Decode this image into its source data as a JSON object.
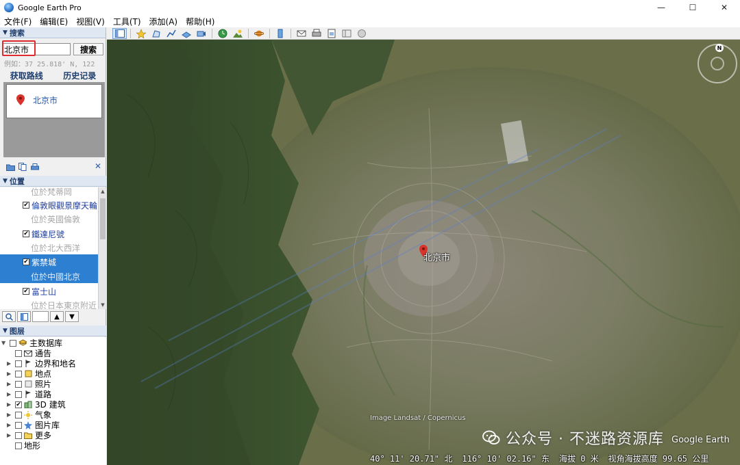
{
  "window": {
    "title": "Google Earth Pro",
    "minimize": "—",
    "maximize": "☐",
    "close": "✕"
  },
  "menu": [
    "文件(F)",
    "编辑(E)",
    "视图(V)",
    "工具(T)",
    "添加(A)",
    "帮助(H)"
  ],
  "search": {
    "section_title": "搜索",
    "value": "北京市",
    "button": "搜索",
    "example": "例如：37 25.818' N, 122",
    "link_route": "获取路线",
    "link_history": "历史记录",
    "result": "北京市"
  },
  "places": {
    "section_title": "位置",
    "rows": [
      {
        "sub": "位於梵蒂岡"
      },
      {
        "name": "倫敦眼觀景摩天輪",
        "checked": "✔"
      },
      {
        "sub": "位於英國倫敦"
      },
      {
        "name": "鐵達尼號",
        "checked": "✔"
      },
      {
        "sub": "位於北大西洋"
      },
      {
        "name": "紫禁城",
        "checked": "✔"
      },
      {
        "sub": "位於中國北京"
      },
      {
        "name": "富士山",
        "checked": "✔"
      },
      {
        "sub": "位於日本東京附近"
      }
    ]
  },
  "layers": {
    "section_title": "图层",
    "items": [
      {
        "label": "主数据库",
        "checked": ""
      },
      {
        "label": "通告",
        "checked": ""
      },
      {
        "label": "边界和地名",
        "checked": ""
      },
      {
        "label": "地点",
        "checked": ""
      },
      {
        "label": "照片",
        "checked": ""
      },
      {
        "label": "道路",
        "checked": ""
      },
      {
        "label": "3D 建筑",
        "checked": "✔"
      },
      {
        "label": "气象",
        "checked": ""
      },
      {
        "label": "图片库",
        "checked": ""
      },
      {
        "label": "更多",
        "checked": ""
      },
      {
        "label": "地形",
        "checked": ""
      }
    ]
  },
  "map": {
    "label": "北京市",
    "attribution": "Image Landsat / Copernicus",
    "brand": "Google Earth",
    "compass_n": "N",
    "watermark": "公众号 · 不迷路资源库",
    "status": {
      "lat": "40° 11' 20.71\" 北",
      "lon": "116° 10' 02.16\" 东",
      "elev": "海拔   0 米",
      "eye": "视角海拔高度  99.65 公里"
    }
  },
  "colors": {
    "accent": "#2d7fd2",
    "highlight": "#e0292f",
    "link": "#1f3d6b"
  }
}
